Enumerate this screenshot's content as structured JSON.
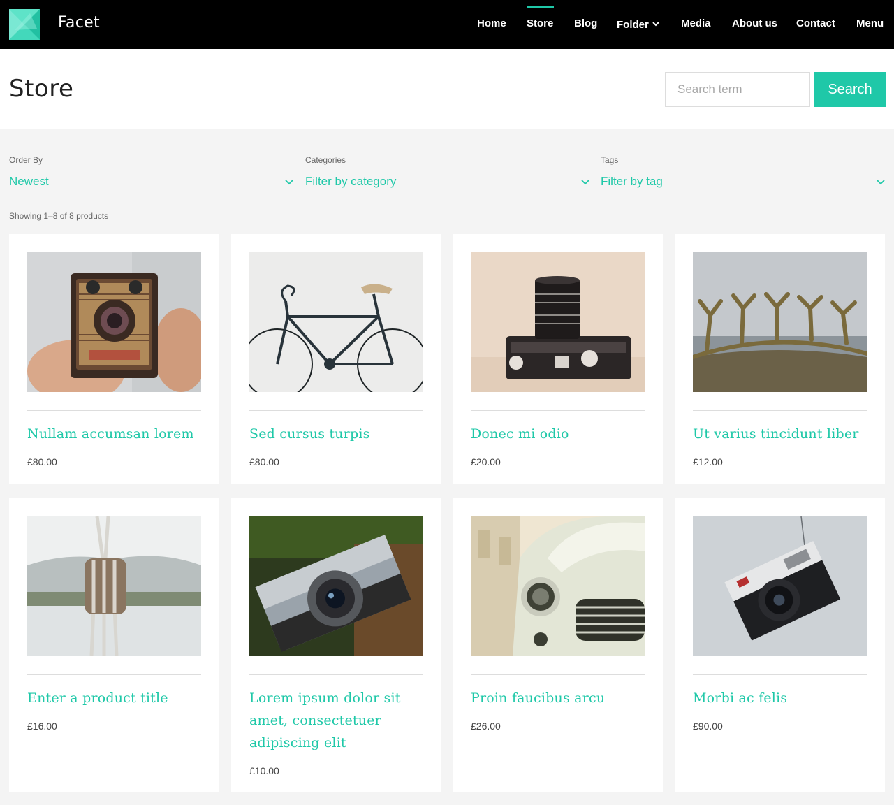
{
  "site": {
    "title": "Facet",
    "accent": "#1fc8a8"
  },
  "nav": {
    "items": [
      {
        "label": "Home"
      },
      {
        "label": "Store"
      },
      {
        "label": "Blog"
      },
      {
        "label": "Folder"
      },
      {
        "label": "Media"
      },
      {
        "label": "About us"
      },
      {
        "label": "Contact"
      },
      {
        "label": "Menu"
      }
    ],
    "active": "Store"
  },
  "page": {
    "title": "Store"
  },
  "search": {
    "placeholder": "Search term",
    "button_label": "Search"
  },
  "filters": [
    {
      "label": "Order By",
      "value": "Newest"
    },
    {
      "label": "Categories",
      "value": "Filter by category"
    },
    {
      "label": "Tags",
      "value": "Filter by tag"
    }
  ],
  "results": {
    "summary": "Showing 1–8 of 8 products"
  },
  "products": [
    {
      "title": "Nullam accumsan lorem",
      "price": "£80.00",
      "image": "box-camera"
    },
    {
      "title": "Sed cursus turpis",
      "price": "£80.00",
      "image": "bicycle"
    },
    {
      "title": "Donec mi odio",
      "price": "£20.00",
      "image": "slr-camera"
    },
    {
      "title": "Ut varius tincidunt liber",
      "price": "£12.00",
      "image": "sun-voyager-sculpture"
    },
    {
      "title": "Enter a product title",
      "price": "£16.00",
      "image": "rope-pulley"
    },
    {
      "title": "Lorem ipsum dolor sit amet, consectetuer adipiscing elit",
      "price": "£10.00",
      "image": "vintage-rangefinder-camera"
    },
    {
      "title": "Proin faucibus arcu",
      "price": "£26.00",
      "image": "vintage-car"
    },
    {
      "title": "Morbi ac felis",
      "price": "£90.00",
      "image": "hanging-compact-camera"
    }
  ]
}
